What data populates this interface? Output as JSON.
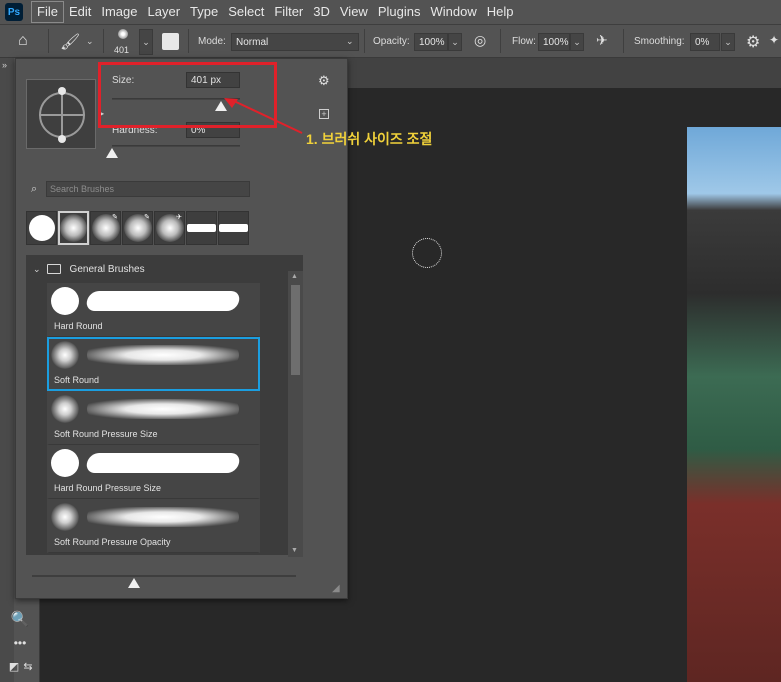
{
  "menubar": {
    "logo": "Ps",
    "items": [
      "File",
      "Edit",
      "Image",
      "Layer",
      "Type",
      "Select",
      "Filter",
      "3D",
      "View",
      "Plugins",
      "Window",
      "Help"
    ]
  },
  "options": {
    "brush_size_value": "401",
    "mode_label": "Mode:",
    "mode_value": "Normal",
    "opacity_label": "Opacity:",
    "opacity_value": "100%",
    "flow_label": "Flow:",
    "flow_value": "100%",
    "smoothing_label": "Smoothing:",
    "smoothing_value": "0%"
  },
  "panel": {
    "size_label": "Size:",
    "size_value": "401 px",
    "size_fraction": 0.85,
    "hardness_label": "Hardness:",
    "hardness_value": "0%",
    "hardness_fraction": 0.0,
    "search_placeholder": "Search Brushes",
    "group_title": "General Brushes",
    "brushes": [
      {
        "name": "Hard Round",
        "type": "hard",
        "selected": false
      },
      {
        "name": "Soft Round",
        "type": "soft",
        "selected": true
      },
      {
        "name": "Soft Round Pressure Size",
        "type": "soft",
        "selected": false
      },
      {
        "name": "Hard Round Pressure Size",
        "type": "hard",
        "selected": false
      },
      {
        "name": "Soft Round Pressure Opacity",
        "type": "soft",
        "selected": false
      }
    ]
  },
  "annotation": {
    "label": "1. 브러쉬 사이즈 조절",
    "box_color": "#e0212a",
    "text_color": "#f0d13a"
  },
  "colors": {
    "accent_selection": "#1b9ee0"
  }
}
